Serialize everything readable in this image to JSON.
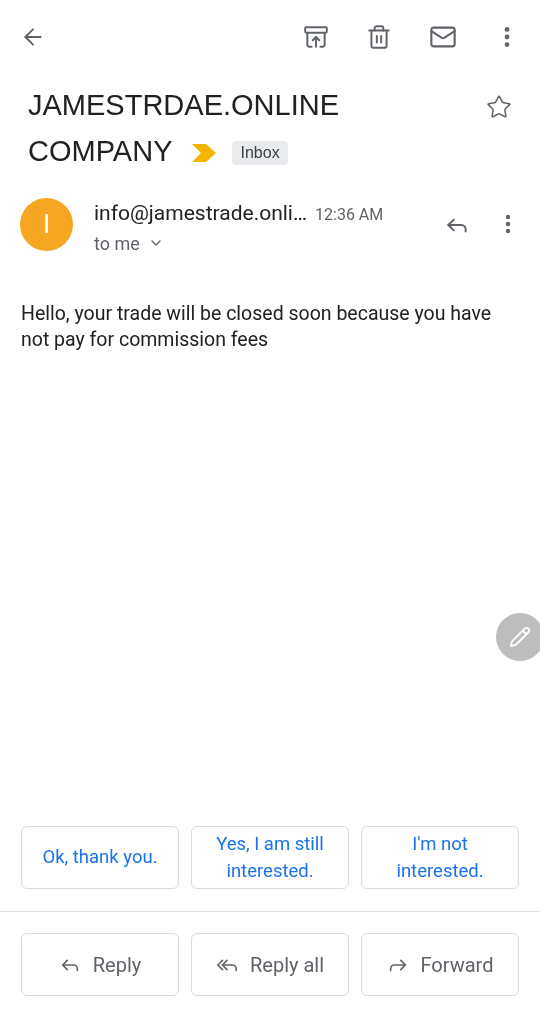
{
  "subject": {
    "title_lines": [
      "JAMESTRDAE.ONLINE",
      "COMPANY"
    ],
    "important": true,
    "label": "Inbox",
    "starred": false
  },
  "message": {
    "avatar": {
      "letter": "I",
      "color": "#f6a623"
    },
    "sender": "info@jamestrade.onli…",
    "time": "12:36 AM",
    "recipient": "to me",
    "body": "Hello, your trade will be closed soon because you have not pay for commission fees"
  },
  "smart_replies": [
    "Ok, thank you.",
    "Yes, I am still interested.",
    "I'm not interested."
  ],
  "actions": [
    {
      "kind": "reply",
      "label": "Reply"
    },
    {
      "kind": "reply_all",
      "label": "Reply all"
    },
    {
      "kind": "forward",
      "label": "Forward"
    }
  ]
}
